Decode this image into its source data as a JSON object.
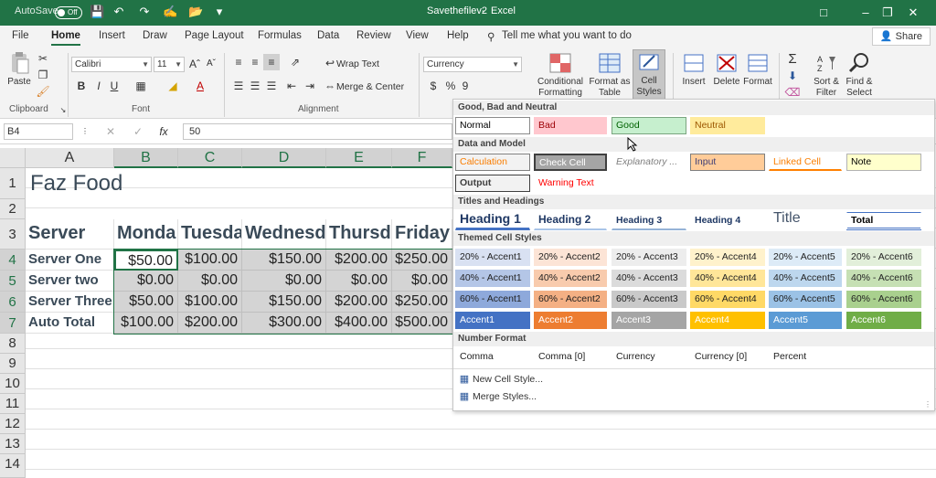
{
  "titlebar": {
    "autosave_label": "AutoSave",
    "autosave_state": "Off",
    "file_title": "Savethefilev2",
    "separator": "-",
    "app_name": "Excel",
    "colors": {
      "bg": "#217346"
    }
  },
  "menu": {
    "tabs": [
      "File",
      "Home",
      "Insert",
      "Draw",
      "Page Layout",
      "Formulas",
      "Data",
      "Review",
      "View",
      "Help"
    ],
    "active": "Home",
    "search_text": "Tell me what you want to do",
    "share_label": "Share"
  },
  "ribbon": {
    "clipboard": {
      "paste": "Paste",
      "label": "Clipboard"
    },
    "font": {
      "family": "Calibri",
      "size": "11",
      "label": "Font"
    },
    "alignment": {
      "wrap": "Wrap Text",
      "merge": "Merge & Center",
      "label": "Alignment"
    },
    "number": {
      "format": "Currency",
      "symbols": [
        "$",
        "%",
        "9"
      ]
    },
    "styles": {
      "conditional": [
        "Conditional",
        "Formatting"
      ],
      "format_as": [
        "Format as",
        "Table"
      ],
      "cell_styles": [
        "Cell",
        "Styles"
      ]
    },
    "cells": {
      "insert": "Insert",
      "delete": "Delete",
      "format": "Format"
    },
    "editing": {
      "sort": [
        "Sort &",
        "Filter"
      ],
      "find": [
        "Find &",
        "Select"
      ]
    }
  },
  "formula_bar": {
    "name_box": "B4",
    "fx": "fx",
    "value": "50"
  },
  "sheet": {
    "columns": [
      "A",
      "B",
      "C",
      "D",
      "E",
      "F"
    ],
    "rows": [
      "1",
      "2",
      "3",
      "4",
      "5",
      "6",
      "7",
      "8",
      "9",
      "10",
      "11",
      "12",
      "13",
      "14"
    ],
    "title": "Faz Food",
    "headers": [
      "Server",
      "Monda",
      "Tuesda",
      "Wednesd",
      "Thursd",
      "Friday"
    ],
    "data": [
      {
        "name": "Server One",
        "values": [
          "$50.00",
          "$100.00",
          "$150.00",
          "$200.00",
          "$250.00"
        ]
      },
      {
        "name": "Server two",
        "values": [
          "$0.00",
          "$0.00",
          "$0.00",
          "$0.00",
          "$0.00"
        ]
      },
      {
        "name": "Server Three",
        "values": [
          "$50.00",
          "$100.00",
          "$150.00",
          "$200.00",
          "$250.00"
        ]
      },
      {
        "name": "Auto Total",
        "values": [
          "$100.00",
          "$200.00",
          "$300.00",
          "$400.00",
          "$500.00"
        ]
      }
    ]
  },
  "cell_styles": {
    "sections": {
      "good_bad": "Good, Bad and Neutral",
      "data_model": "Data and Model",
      "titles": "Titles and Headings",
      "themed": "Themed Cell Styles",
      "number": "Number Format"
    },
    "good_bad": [
      "Normal",
      "Bad",
      "Good",
      "Neutral"
    ],
    "data_model": [
      "Calculation",
      "Check Cell",
      "Explanatory ...",
      "Input",
      "Linked Cell",
      "Note",
      "Output",
      "Warning Text"
    ],
    "titles": [
      "Heading 1",
      "Heading 2",
      "Heading 3",
      "Heading 4",
      "Title",
      "Total"
    ],
    "themed_20": [
      "20% - Accent1",
      "20% - Accent2",
      "20% - Accent3",
      "20% - Accent4",
      "20% - Accent5",
      "20% - Accent6"
    ],
    "themed_40": [
      "40% - Accent1",
      "40% - Accent2",
      "40% - Accent3",
      "40% - Accent4",
      "40% - Accent5",
      "40% - Accent6"
    ],
    "themed_60": [
      "60% - Accent1",
      "60% - Accent2",
      "60% - Accent3",
      "60% - Accent4",
      "60% - Accent5",
      "60% - Accent6"
    ],
    "accents": [
      "Accent1",
      "Accent2",
      "Accent3",
      "Accent4",
      "Accent5",
      "Accent6"
    ],
    "number_formats": [
      "Comma",
      "Comma [0]",
      "Currency",
      "Currency [0]",
      "Percent"
    ],
    "new_style": "New Cell Style...",
    "merge_styles": "Merge Styles...",
    "accent_colors": [
      "#4472c4",
      "#ed7d31",
      "#a5a5a5",
      "#ffc000",
      "#5b9bd5",
      "#70ad47"
    ]
  }
}
